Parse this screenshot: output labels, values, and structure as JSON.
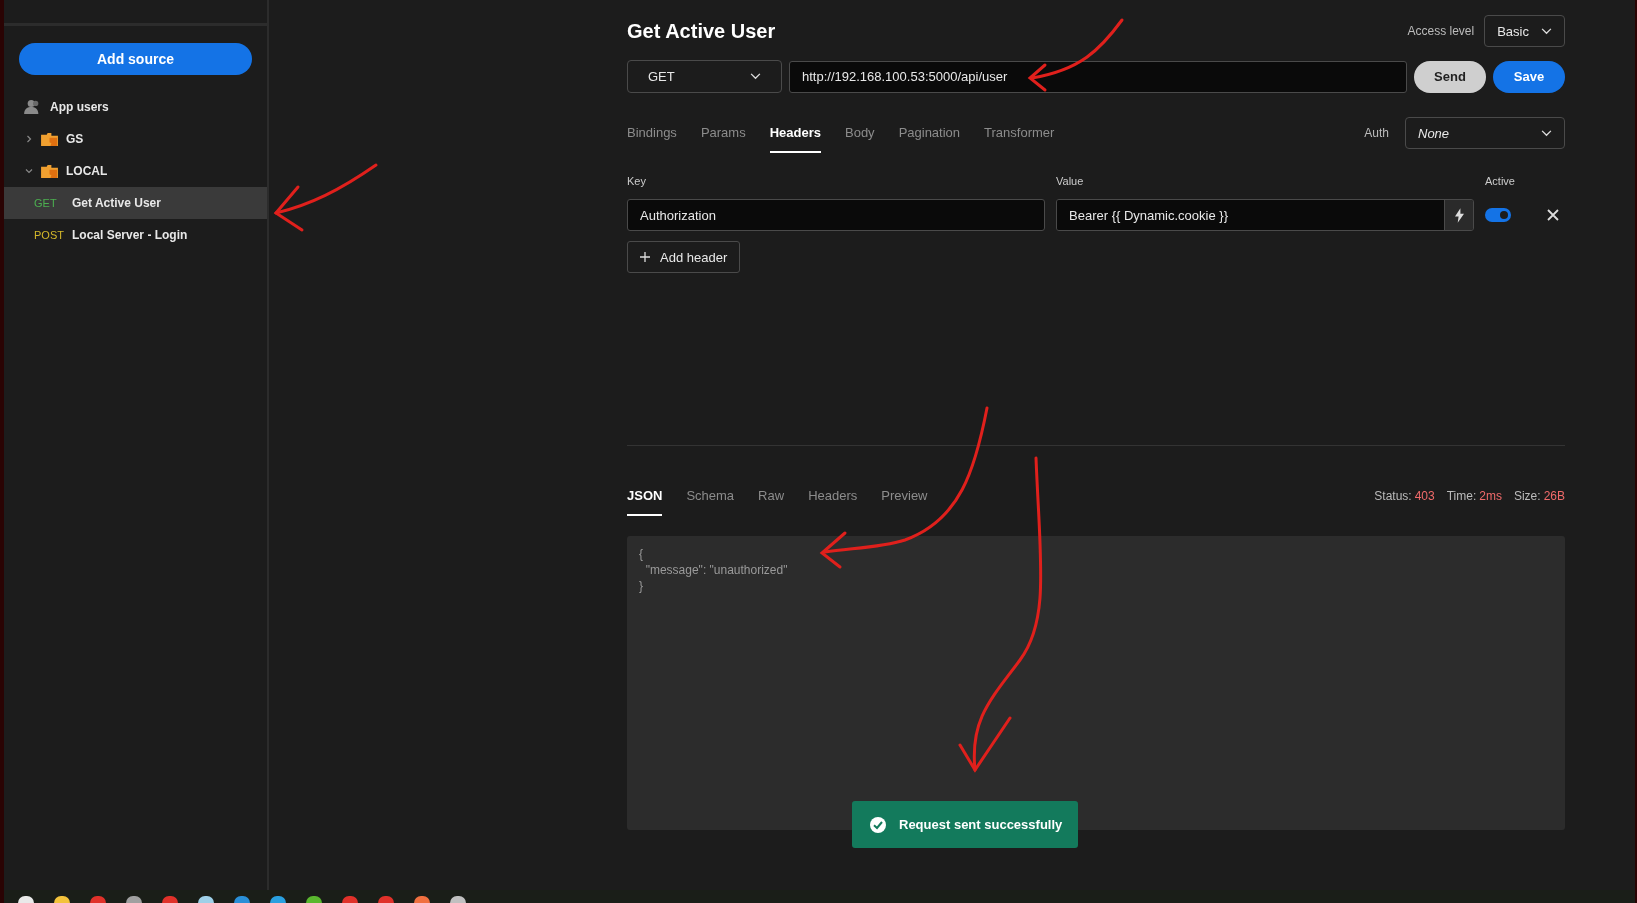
{
  "sidebar": {
    "add_button": "Add source",
    "items": [
      {
        "kind": "users",
        "label": "App users"
      },
      {
        "kind": "folder",
        "label": "GS",
        "expanded": false
      },
      {
        "kind": "folder",
        "label": "LOCAL",
        "expanded": true,
        "children": [
          {
            "method": "GET",
            "color": "#4caf50",
            "label": "Get Active User",
            "selected": true
          },
          {
            "method": "POST",
            "color": "#d4b82a",
            "label": "Local Server - Login",
            "selected": false
          }
        ]
      }
    ]
  },
  "request": {
    "title": "Get Active User",
    "access_level_label": "Access level",
    "access_level": "Basic",
    "method": "GET",
    "url": "http://192.168.100.53:5000/api/user",
    "send": "Send",
    "save": "Save",
    "tabs": [
      {
        "label": "Bindings",
        "selected": false
      },
      {
        "label": "Params",
        "selected": false
      },
      {
        "label": "Headers",
        "selected": true
      },
      {
        "label": "Body",
        "selected": false
      },
      {
        "label": "Pagination",
        "selected": false
      },
      {
        "label": "Transformer",
        "selected": false
      }
    ],
    "auth_label": "Auth",
    "auth_value": "None",
    "header_columns": [
      "Key",
      "Value",
      "Active"
    ],
    "headers": [
      {
        "key": "Authorization",
        "value": "Bearer {{ Dynamic.cookie }}",
        "active": true
      }
    ],
    "add_header": "Add header"
  },
  "response": {
    "tabs": [
      {
        "label": "JSON",
        "selected": true
      },
      {
        "label": "Schema",
        "selected": false
      },
      {
        "label": "Raw",
        "selected": false
      },
      {
        "label": "Headers",
        "selected": false
      },
      {
        "label": "Preview",
        "selected": false
      }
    ],
    "stats": [
      {
        "label": "Status:",
        "value": "403"
      },
      {
        "label": "Time:",
        "value": "2ms"
      },
      {
        "label": "Size:",
        "value": "26B"
      }
    ],
    "body": [
      "{",
      "  \"message\": \"unauthorized\"",
      "}"
    ]
  },
  "toast": {
    "text": "Request sent successfully"
  }
}
